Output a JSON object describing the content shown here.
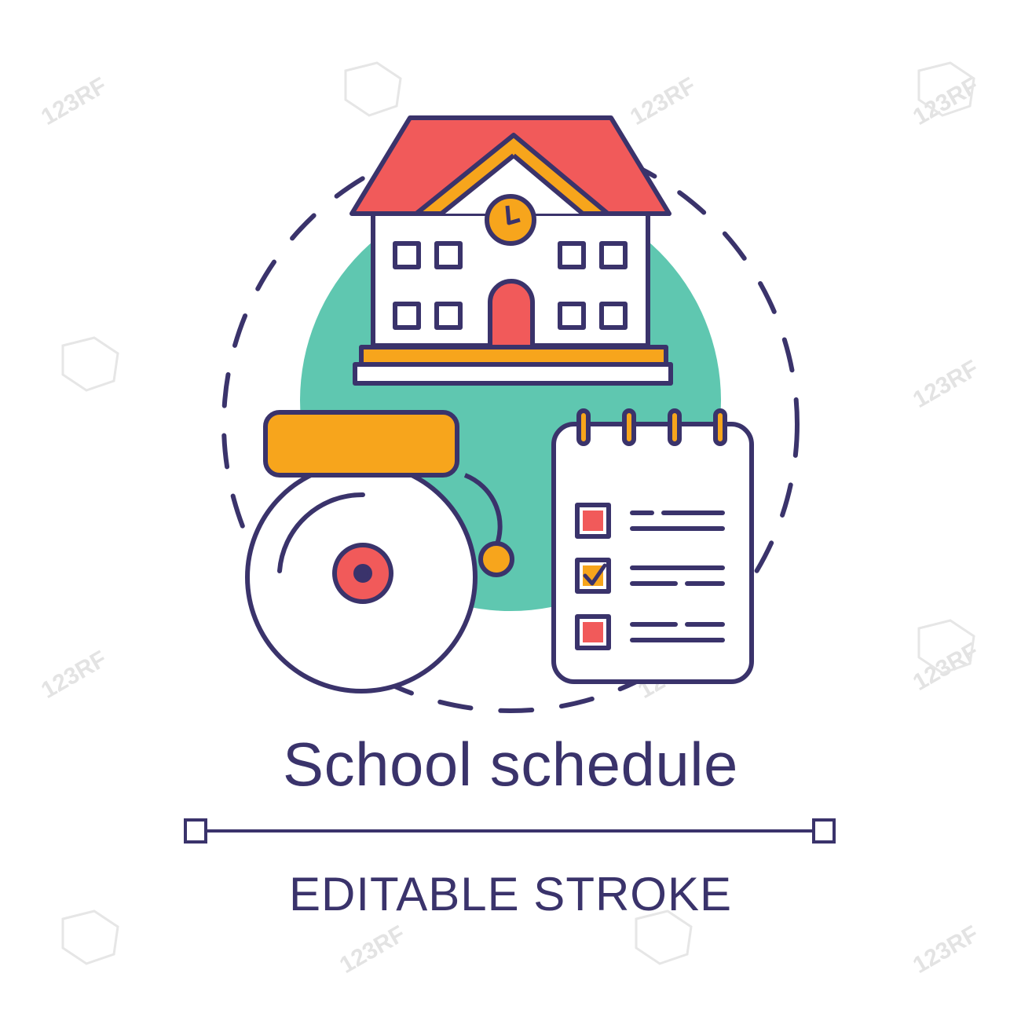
{
  "title": "School schedule",
  "subtitle": "EDITABLE STROKE",
  "watermark": {
    "text": "123RF"
  },
  "colors": {
    "outline": "#3a336b",
    "roof_red": "#f15a5a",
    "accent_orange": "#f7a51c",
    "circle_teal": "#5fc7b0",
    "background": "#ffffff"
  },
  "icons": [
    "school-building-icon",
    "clock-icon",
    "school-bell-icon",
    "checklist-notepad-icon"
  ]
}
